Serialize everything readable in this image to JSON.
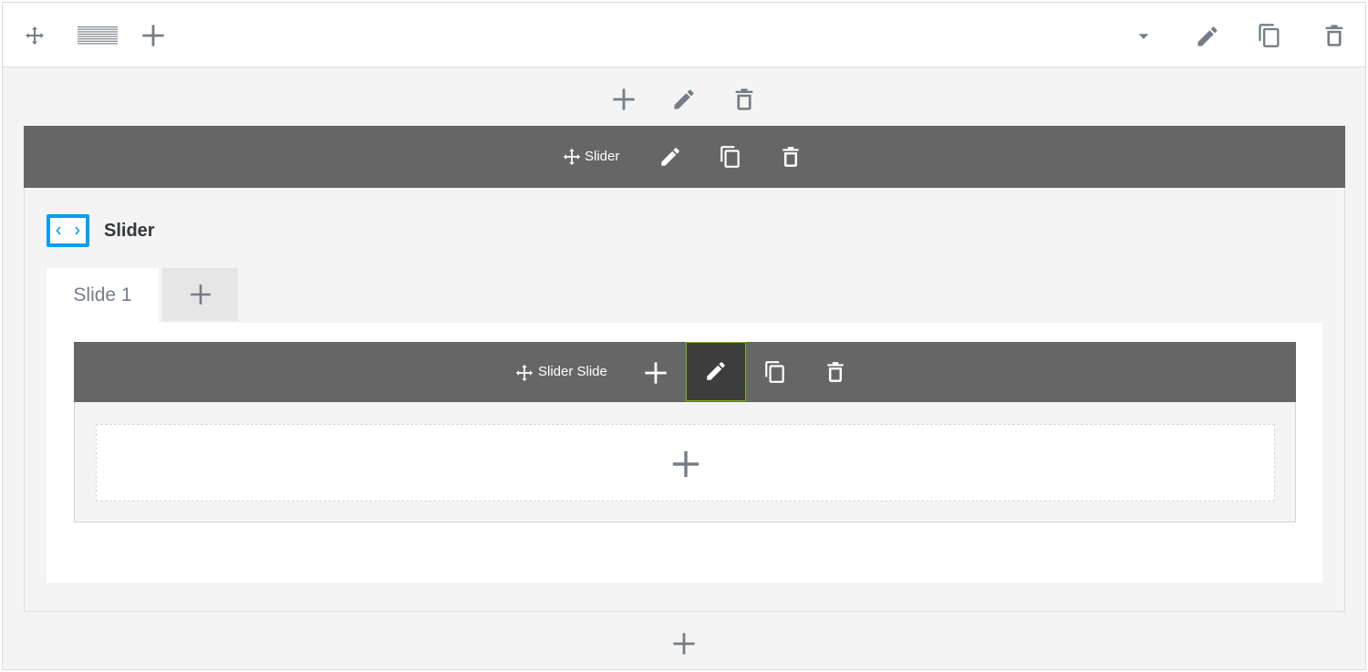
{
  "row_toolbar": {
    "move_icon": "move-arrows-icon",
    "layout_icon": "row-layout-icon",
    "add_icon": "plus-icon",
    "dropdown_icon": "caret-down-icon",
    "edit_icon": "pencil-icon",
    "duplicate_icon": "copy-icon",
    "delete_icon": "trash-icon"
  },
  "column_toolbar": {
    "add_icon": "plus-icon",
    "edit_icon": "pencil-icon",
    "delete_icon": "trash-icon"
  },
  "module": {
    "bar_label": "Slider",
    "title": "Slider",
    "icon": "slider-arrows-icon",
    "accent_color": "#00a0f0",
    "tabs": [
      {
        "label": "Slide 1",
        "active": true
      }
    ],
    "add_tab_icon": "plus-icon"
  },
  "slide": {
    "bar_label": "Slider Slide",
    "active_action": "edit",
    "active_border_color": "#79b31d",
    "add_block_icon": "plus-icon"
  },
  "bottom": {
    "add_icon": "plus-icon"
  },
  "colors": {
    "toolbar_bg": "#666666",
    "canvas_bg": "#f4f4f4",
    "icon_gray": "#757d86"
  }
}
